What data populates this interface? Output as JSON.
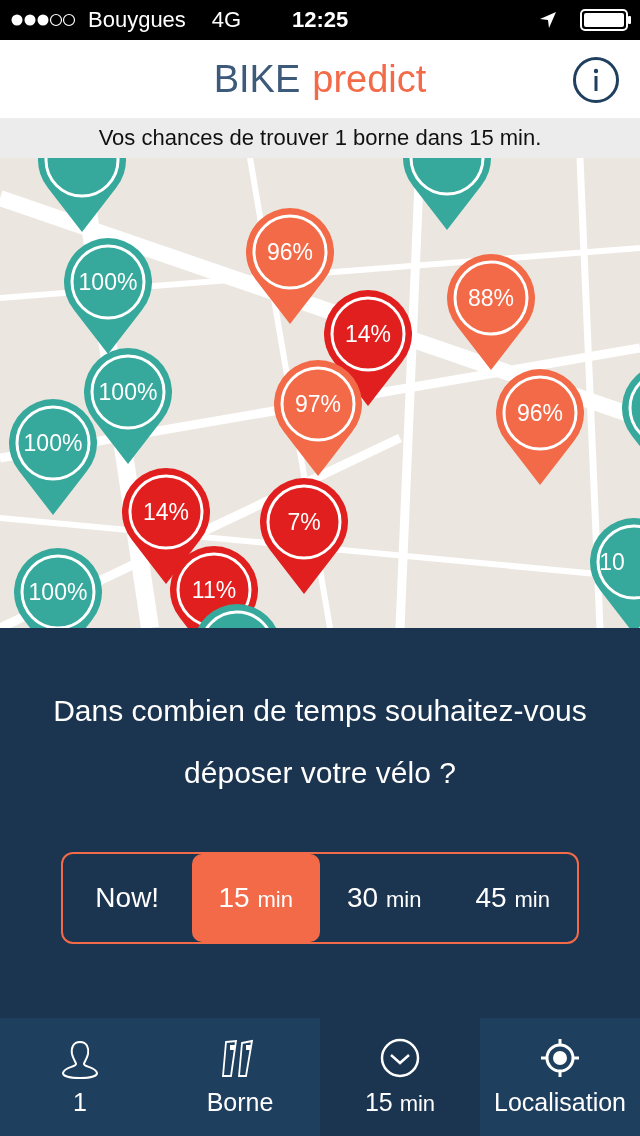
{
  "status_bar": {
    "carrier": "Bouygues",
    "network": "4G",
    "time": "12:25"
  },
  "header": {
    "brand_first": "BIKE",
    "brand_second": "predict"
  },
  "info_bar": {
    "text": "Vos chances de trouver 1 borne dans 15 min."
  },
  "map": {
    "kind": "picture",
    "pins": [
      {
        "color": "#36a99c"
      },
      {
        "color": "#36a99c"
      },
      {
        "label": "96%",
        "color": "#f26a48"
      },
      {
        "label": "100%",
        "color": "#36a99c"
      },
      {
        "label": "100%",
        "color": "#36a99c"
      },
      {
        "label": "88%",
        "color": "#f26a48"
      },
      {
        "label": "14%",
        "color": "#e11f1e"
      },
      {
        "label": "97%",
        "color": "#f26a48"
      },
      {
        "label": "96%",
        "color": "#f26a48"
      },
      {
        "color": "#36a99c"
      },
      {
        "label": "100%",
        "color": "#36a99c"
      },
      {
        "label": "14%",
        "color": "#e11f1e"
      },
      {
        "label": "7%",
        "color": "#e11f1e"
      },
      {
        "label": "11%",
        "color": "#e11f1e"
      },
      {
        "label": "100%",
        "color": "#36a99c"
      },
      {
        "color": "#36a99c"
      },
      {
        "label": "10",
        "color": "#36a99c"
      }
    ]
  },
  "panel": {
    "question": "Dans combien de temps souhaitez-vous déposer votre vélo ?",
    "options": [
      {
        "value": "Now!",
        "selected": false
      },
      {
        "value": "15",
        "unit": "min",
        "selected": true
      },
      {
        "value": "30",
        "unit": "min",
        "selected": false
      },
      {
        "value": "45",
        "unit": "min",
        "selected": false
      }
    ]
  },
  "tab_bar": [
    {
      "value": "1",
      "selected": false
    },
    {
      "value": "Borne",
      "selected": false
    },
    {
      "value": "15",
      "unit": "min",
      "selected": true
    },
    {
      "value": "Localisation",
      "selected": false
    }
  ]
}
